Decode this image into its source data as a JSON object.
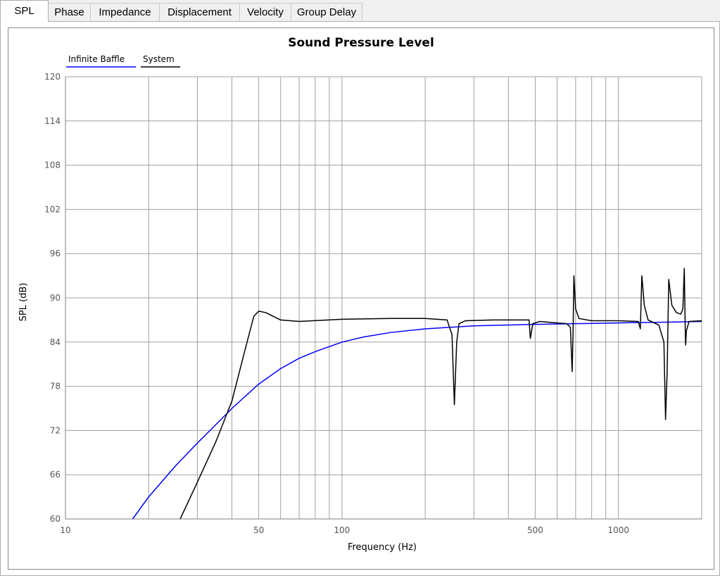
{
  "tabs": [
    {
      "label": "SPL",
      "active": true
    },
    {
      "label": "Phase"
    },
    {
      "label": "Impedance"
    },
    {
      "label": "Displacement"
    },
    {
      "label": "Velocity"
    },
    {
      "label": "Group Delay"
    }
  ],
  "chart_data": {
    "type": "line",
    "title": "Sound Pressure Level",
    "xlabel": "Frequency (Hz)",
    "ylabel": "SPL (dB)",
    "x_scale": "log",
    "xlim": [
      10,
      2000
    ],
    "ylim": [
      60,
      120
    ],
    "x_tick_labels": [
      {
        "value": 10,
        "label": "10"
      },
      {
        "value": 50,
        "label": "50"
      },
      {
        "value": 100,
        "label": "100"
      },
      {
        "value": 500,
        "label": "500"
      },
      {
        "value": 1000,
        "label": "1000"
      }
    ],
    "y_ticks": [
      60,
      66,
      72,
      78,
      84,
      90,
      96,
      102,
      108,
      114,
      120
    ],
    "grid": true,
    "legend_position": "top-left",
    "series": [
      {
        "name": "Infinite Baffle",
        "color": "#0000ff",
        "points": [
          [
            17.5,
            60
          ],
          [
            20,
            63
          ],
          [
            25,
            67.2
          ],
          [
            30,
            70.3
          ],
          [
            35,
            72.8
          ],
          [
            40,
            75.0
          ],
          [
            50,
            78.3
          ],
          [
            60,
            80.4
          ],
          [
            70,
            81.8
          ],
          [
            80,
            82.7
          ],
          [
            100,
            84.0
          ],
          [
            120,
            84.7
          ],
          [
            150,
            85.3
          ],
          [
            200,
            85.8
          ],
          [
            300,
            86.2
          ],
          [
            500,
            86.4
          ],
          [
            1000,
            86.6
          ],
          [
            1500,
            86.7
          ],
          [
            2000,
            86.8
          ]
        ]
      },
      {
        "name": "System",
        "color": "#000000",
        "points": [
          [
            26,
            60
          ],
          [
            30,
            65
          ],
          [
            35,
            70.5
          ],
          [
            40,
            76
          ],
          [
            45,
            83.5
          ],
          [
            48,
            87.5
          ],
          [
            50,
            88.2
          ],
          [
            53,
            88.0
          ],
          [
            60,
            87.0
          ],
          [
            70,
            86.8
          ],
          [
            100,
            87.1
          ],
          [
            150,
            87.2
          ],
          [
            200,
            87.2
          ],
          [
            240,
            87.0
          ],
          [
            250,
            85
          ],
          [
            255,
            75.5
          ],
          [
            260,
            84
          ],
          [
            265,
            86.5
          ],
          [
            280,
            86.9
          ],
          [
            350,
            87
          ],
          [
            475,
            87
          ],
          [
            480,
            84.5
          ],
          [
            490,
            86.5
          ],
          [
            520,
            86.8
          ],
          [
            600,
            86.6
          ],
          [
            650,
            86.5
          ],
          [
            670,
            86.0
          ],
          [
            680,
            80
          ],
          [
            685,
            85
          ],
          [
            690,
            93
          ],
          [
            700,
            88.5
          ],
          [
            720,
            87.2
          ],
          [
            800,
            86.9
          ],
          [
            1000,
            86.9
          ],
          [
            1180,
            86.8
          ],
          [
            1200,
            85.8
          ],
          [
            1215,
            93
          ],
          [
            1240,
            89
          ],
          [
            1280,
            87.0
          ],
          [
            1400,
            86.3
          ],
          [
            1460,
            84
          ],
          [
            1480,
            73.5
          ],
          [
            1500,
            80
          ],
          [
            1520,
            92.5
          ],
          [
            1560,
            89
          ],
          [
            1620,
            88
          ],
          [
            1680,
            87.8
          ],
          [
            1710,
            88.5
          ],
          [
            1730,
            94
          ],
          [
            1745,
            85
          ],
          [
            1750,
            83.6
          ],
          [
            1760,
            85.5
          ],
          [
            1800,
            86.8
          ],
          [
            2000,
            86.9
          ]
        ]
      }
    ]
  }
}
